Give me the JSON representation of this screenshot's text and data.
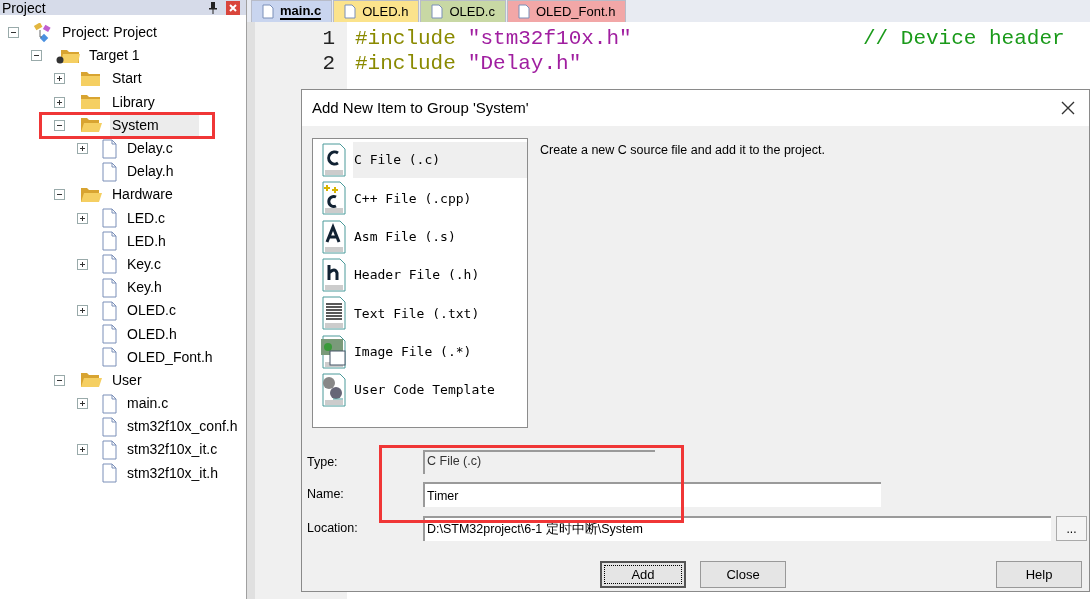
{
  "project_panel": {
    "title": "Project",
    "tree": [
      {
        "kind": "project",
        "label": "Project: Project",
        "expanded": true,
        "children": [
          {
            "kind": "target",
            "label": "Target 1",
            "expanded": true,
            "children": [
              {
                "kind": "group",
                "label": "Start",
                "expanded": false
              },
              {
                "kind": "group",
                "label": "Library",
                "expanded": false
              },
              {
                "kind": "group",
                "label": "System",
                "expanded": true,
                "selected": true,
                "marked": true,
                "children": [
                  {
                    "kind": "file",
                    "label": "Delay.c",
                    "expanded": false
                  },
                  {
                    "kind": "file",
                    "label": "Delay.h"
                  }
                ]
              },
              {
                "kind": "group",
                "label": "Hardware",
                "expanded": true,
                "children": [
                  {
                    "kind": "file",
                    "label": "LED.c",
                    "expanded": false
                  },
                  {
                    "kind": "file",
                    "label": "LED.h"
                  },
                  {
                    "kind": "file",
                    "label": "Key.c",
                    "expanded": false
                  },
                  {
                    "kind": "file",
                    "label": "Key.h"
                  },
                  {
                    "kind": "file",
                    "label": "OLED.c",
                    "expanded": false
                  },
                  {
                    "kind": "file",
                    "label": "OLED.h"
                  },
                  {
                    "kind": "file",
                    "label": "OLED_Font.h"
                  }
                ]
              },
              {
                "kind": "group",
                "label": "User",
                "expanded": true,
                "children": [
                  {
                    "kind": "file",
                    "label": "main.c",
                    "expanded": false
                  },
                  {
                    "kind": "file",
                    "label": "stm32f10x_conf.h"
                  },
                  {
                    "kind": "file",
                    "label": "stm32f10x_it.c",
                    "expanded": false
                  },
                  {
                    "kind": "file",
                    "label": "stm32f10x_it.h"
                  }
                ]
              }
            ]
          }
        ]
      }
    ]
  },
  "tabs": [
    {
      "label": "main.c",
      "selected": true,
      "color": "#c9d5ef"
    },
    {
      "label": "OLED.h",
      "selected": false,
      "color": "#fbe38c"
    },
    {
      "label": "OLED.c",
      "selected": false,
      "color": "#c8d8a4"
    },
    {
      "label": "OLED_Font.h",
      "selected": false,
      "color": "#f2a7a7"
    }
  ],
  "editor": {
    "lines": [
      {
        "number": "1",
        "tokens": [
          {
            "kind": "directive",
            "text": "#include"
          },
          {
            "kind": "string",
            "text": "\"stm32f10x.h\""
          },
          {
            "kind": "comment",
            "text": "// Device header"
          }
        ]
      },
      {
        "number": "2",
        "tokens": [
          {
            "kind": "directive",
            "text": "#include"
          },
          {
            "kind": "string",
            "text": "\"Delay.h\""
          }
        ]
      }
    ]
  },
  "dialog": {
    "title": "Add New Item to Group 'System'",
    "items": [
      {
        "kind": "c",
        "label": "C File (.c)",
        "selected": true
      },
      {
        "kind": "cpp",
        "label": "C++ File (.cpp)",
        "selected": false
      },
      {
        "kind": "asm",
        "label": "Asm File (.s)",
        "selected": false
      },
      {
        "kind": "header",
        "label": "Header File (.h)",
        "selected": false
      },
      {
        "kind": "text",
        "label": "Text File (.txt)",
        "selected": false
      },
      {
        "kind": "image",
        "label": "Image File (.*)",
        "selected": false
      },
      {
        "kind": "template",
        "label": "User Code Template",
        "selected": false
      }
    ],
    "description": "Create a new C source file and add it to the project.",
    "type": {
      "label": "Type:",
      "value": "C File (.c)"
    },
    "name": {
      "label": "Name:",
      "value": "Timer"
    },
    "location": {
      "label": "Location:",
      "value": "D:\\STM32project\\6-1 定时中断\\System",
      "browse": "..."
    },
    "fields_marked": true,
    "buttons": [
      {
        "label": "Add",
        "default": true
      },
      {
        "label": "Close",
        "default": false
      },
      {
        "label": "Help",
        "default": false
      }
    ]
  }
}
